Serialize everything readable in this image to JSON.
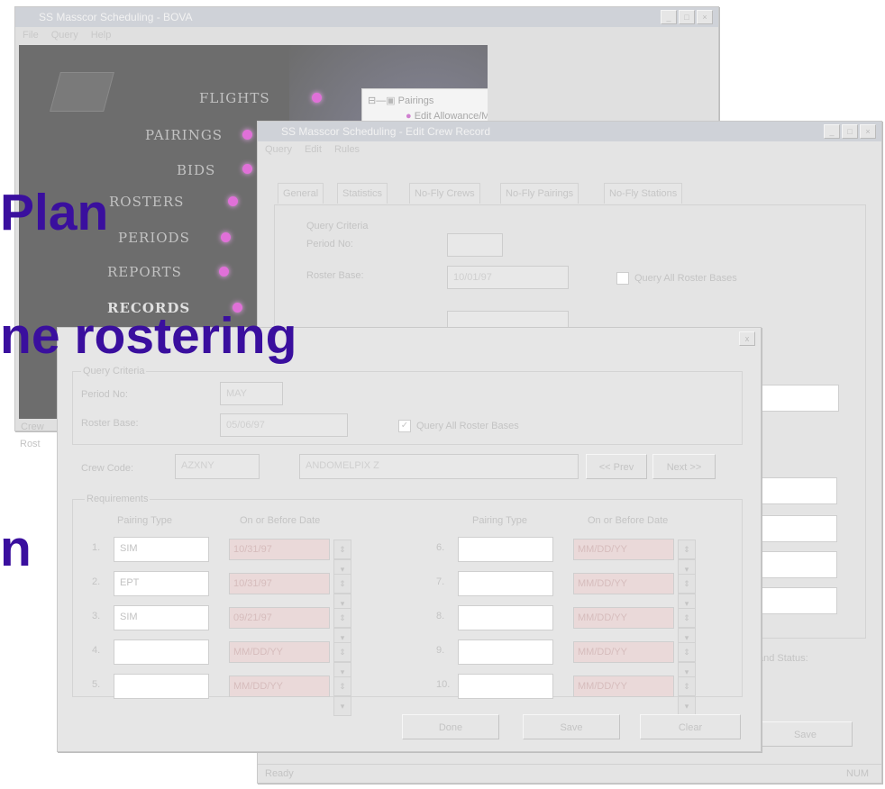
{
  "back_window": {
    "title": "SS Masscor Scheduling - BOVA",
    "menu": [
      "File",
      "Query",
      "Help"
    ],
    "nav": [
      "FLIGHTS",
      "PAIRINGS",
      "BIDS",
      "ROSTERS",
      "PERIODS",
      "REPORTS",
      "RECORDS"
    ],
    "tree": {
      "root": "Pairings",
      "child": "Edit Allowance/Meal Rules"
    },
    "side_labels": [
      "Crew",
      "Rost"
    ]
  },
  "edit_crew_window": {
    "title": "SS Masscor Scheduling - Edit Crew Record",
    "menu": [
      "Query",
      "Edit",
      "Rules"
    ],
    "tabs": [
      "General",
      "Statistics",
      "No-Fly Crews",
      "No-Fly Pairings",
      "No-Fly Stations"
    ],
    "group_label": "Query Criteria",
    "period_label": "Period No:",
    "roster_base_label": "Roster Base:",
    "roster_base_value": "10/01/97",
    "query_all_label": "Query All Roster Bases",
    "side_label": "and Status:",
    "save_button": "Save",
    "status_ready": "Ready",
    "status_num": "NUM"
  },
  "front_dialog": {
    "close": "x",
    "group_label": "Query Criteria",
    "period_label": "Period No:",
    "period_value": "MAY",
    "roster_base_label": "Roster Base:",
    "roster_base_value": "05/06/97",
    "query_all_label": "Query All Roster Bases",
    "crew_code_label": "Crew Code:",
    "crew_code_value": "AZXNY",
    "crew_name_value": "ANDOMELPIX Z",
    "prev_button": "<< Prev",
    "next_button": "Next >>",
    "requirements_label": "Requirements",
    "col_pairing_type": "Pairing Type",
    "col_on_before_date": "On or Before Date",
    "left_rows": [
      {
        "num": "1.",
        "type": "SIM",
        "date": "10/31/97"
      },
      {
        "num": "2.",
        "type": "EPT",
        "date": "10/31/97"
      },
      {
        "num": "3.",
        "type": "SIM",
        "date": "09/21/97"
      },
      {
        "num": "4.",
        "type": "",
        "date": "MM/DD/YY"
      },
      {
        "num": "5.",
        "type": "",
        "date": "MM/DD/YY"
      }
    ],
    "right_rows": [
      {
        "num": "6.",
        "type": "",
        "date": "MM/DD/YY"
      },
      {
        "num": "7.",
        "type": "",
        "date": "MM/DD/YY"
      },
      {
        "num": "8.",
        "type": "",
        "date": "MM/DD/YY"
      },
      {
        "num": "9.",
        "type": "",
        "date": "MM/DD/YY"
      },
      {
        "num": "10.",
        "type": "",
        "date": "MM/DD/YY"
      }
    ],
    "done_button": "Done",
    "save_button": "Save",
    "clear_button": "Clear"
  },
  "slide_text": {
    "line1": "Plan",
    "line2": "ne rostering",
    "line3": "n"
  },
  "colors": {
    "slide_text": "#3a0f9e",
    "nav_dot": "#e070d8",
    "back_panel": "#6d6d6d"
  }
}
